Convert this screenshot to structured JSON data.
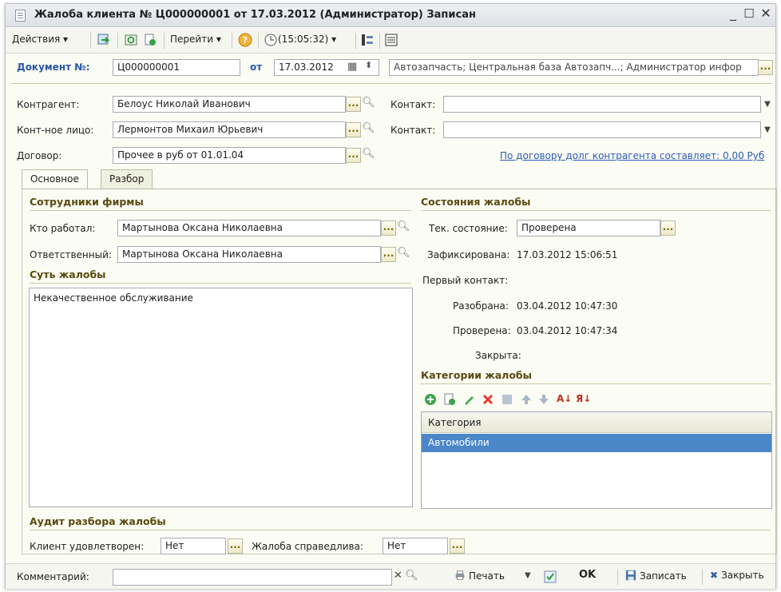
{
  "window": {
    "title": "Жалоба клиента № Ц000000001 от 17.03.2012 (Администратор) Записан"
  },
  "toolbar": {
    "actions": "Действия",
    "goto": "Перейти",
    "time": "(15:05:32)"
  },
  "doc": {
    "number_label": "Документ №:",
    "number": "Ц000000001",
    "date_label": "от",
    "date": "17.03.2012",
    "org": "Автозапчасть; Центральная база Автозапч...; Администратор инфор"
  },
  "form": {
    "counterparty_label": "Контрагент:",
    "counterparty": "Белоус Николай Иванович",
    "contact_person_label": "Конт-ное лицо:",
    "contact_person": "Лермонтов Михаил Юрьевич",
    "contract_label": "Договор:",
    "contract": "Прочее в руб от 01.01.04",
    "contact1_label": "Контакт:",
    "contact1": "",
    "contact2_label": "Контакт:",
    "contact2": "",
    "debt_link": "По договору долг контрагента составляет: 0,00 Руб"
  },
  "tabs": [
    {
      "label": "Основное"
    },
    {
      "label": "Разбор"
    }
  ],
  "staff": {
    "header": "Сотрудники фирмы",
    "worked_label": "Кто работал:",
    "worked": "Мартынова Оксана Николаевна",
    "responsible_label": "Ответственный:",
    "responsible": "Мартынова Оксана Николаевна"
  },
  "essence": {
    "header": "Суть жалобы",
    "text": "Некачественное обслуживание"
  },
  "states": {
    "header": "Состояния жалобы",
    "current_label": "Тек. состояние:",
    "current": "Проверена",
    "fixed_label": "Зафиксирована:",
    "fixed": "17.03.2012 15:06:51",
    "first_contact_label": "Первый контакт:",
    "first_contact": "",
    "parsed_label": "Разобрана:",
    "parsed": "03.04.2012 10:47:30",
    "checked_label": "Проверена:",
    "checked": "03.04.2012 10:47:34",
    "closed_label": "Закрыта:",
    "closed": ""
  },
  "categories": {
    "header": "Категории жалобы",
    "column": "Категория",
    "rows": [
      "Автомобили"
    ]
  },
  "audit": {
    "header": "Аудит разбора жалобы",
    "satisfied_label": "Клиент удовлетворен:",
    "satisfied": "Нет",
    "fair_label": "Жалоба справедлива:",
    "fair": "Нет"
  },
  "footer": {
    "comment_label": "Комментарий:",
    "comment": "",
    "print": "Печать",
    "ok": "OK",
    "save": "Записать",
    "close": "Закрыть"
  },
  "colors": {
    "accent_blue": "#2856a8",
    "selection": "#4a86c8",
    "header_text": "#5a4a10"
  }
}
